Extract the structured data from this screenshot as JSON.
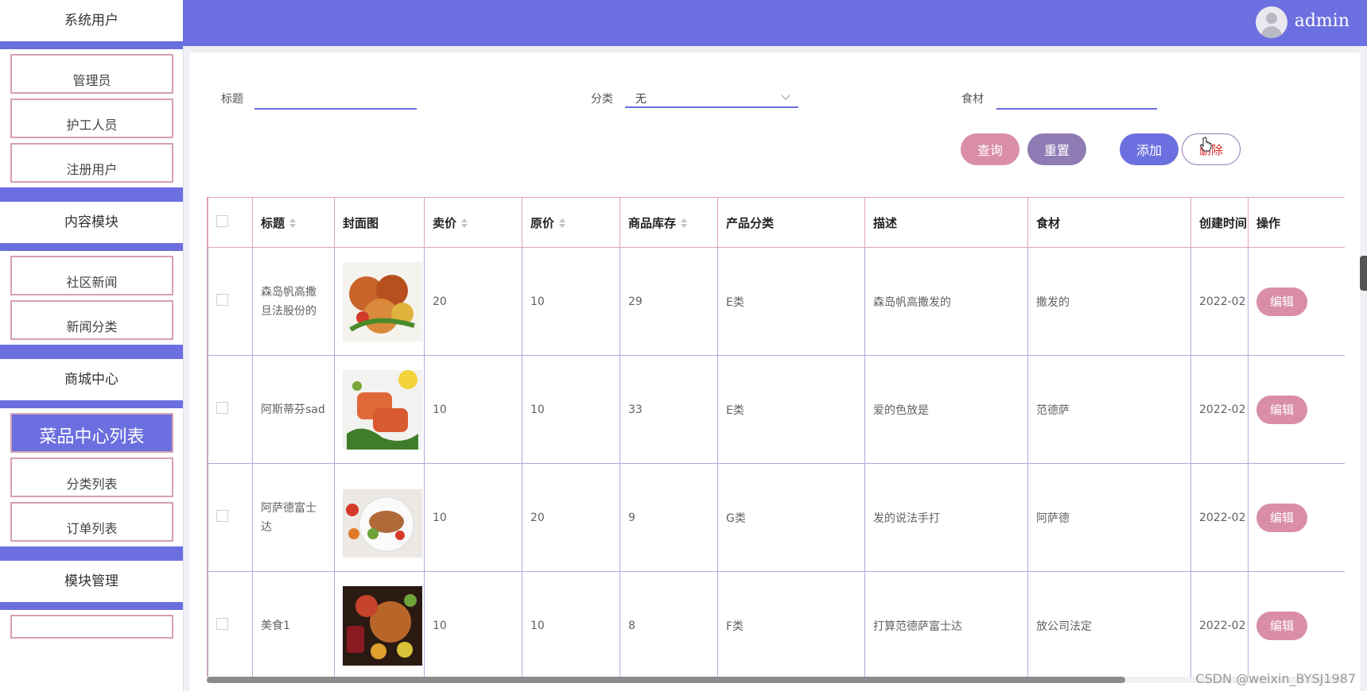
{
  "sidebar": {
    "groups": [
      {
        "title": "系统用户",
        "items": [
          "管理员",
          "护工人员",
          "注册用户"
        ]
      },
      {
        "title": "内容模块",
        "items": [
          "社区新闻",
          "新闻分类"
        ]
      },
      {
        "title": "商城中心",
        "items": [
          "菜品中心列表",
          "分类列表",
          "订单列表"
        ]
      },
      {
        "title": "模块管理",
        "items": []
      }
    ],
    "active_item": "菜品中心列表"
  },
  "header": {
    "username": "admin",
    "avatar_icon": "user-avatar-icon"
  },
  "filters": {
    "title_label": "标题",
    "title_value": "",
    "category_label": "分类",
    "category_value": "无",
    "ingredient_label": "食材",
    "ingredient_value": ""
  },
  "buttons": {
    "query": "查询",
    "reset": "重置",
    "add": "添加",
    "delete": "删除"
  },
  "table": {
    "columns": [
      "标题",
      "封面图",
      "卖价",
      "原价",
      "商品库存",
      "产品分类",
      "描述",
      "食材",
      "创建时间",
      "操作"
    ],
    "sortable": [
      "标题",
      "卖价",
      "原价",
      "商品库存"
    ],
    "rows": [
      {
        "title": "森岛帆高撒旦法股份的",
        "image": "food-image-grilled-chicken",
        "price": "20",
        "original": "10",
        "stock": "29",
        "category": "E类",
        "desc": "森岛帆高撒发的",
        "ingredient": "撒发的",
        "created": "2022-02",
        "action": "编辑"
      },
      {
        "title": "阿斯蒂芬sad",
        "image": "food-image-salmon",
        "price": "10",
        "original": "10",
        "stock": "33",
        "category": "E类",
        "desc": "爱的色放是",
        "ingredient": "范德萨",
        "created": "2022-02",
        "action": "编辑"
      },
      {
        "title": "阿萨德富士达",
        "image": "food-image-salad-plate",
        "price": "10",
        "original": "20",
        "stock": "9",
        "category": "G类",
        "desc": "发的说法手打",
        "ingredient": "阿萨德",
        "created": "2022-02",
        "action": "编辑"
      },
      {
        "title": "美食1",
        "image": "food-image-feast",
        "price": "10",
        "original": "10",
        "stock": "8",
        "category": "F类",
        "desc": "打算范德萨富士达",
        "ingredient": "放公司法定",
        "created": "2022-02",
        "action": "编辑"
      }
    ]
  },
  "watermark": "CSDN @weixin_BYSJ1987",
  "colors": {
    "primary": "#6b6fdf",
    "pink": "#d98ea6",
    "purple": "#8f7cb4",
    "danger": "#d62020"
  }
}
